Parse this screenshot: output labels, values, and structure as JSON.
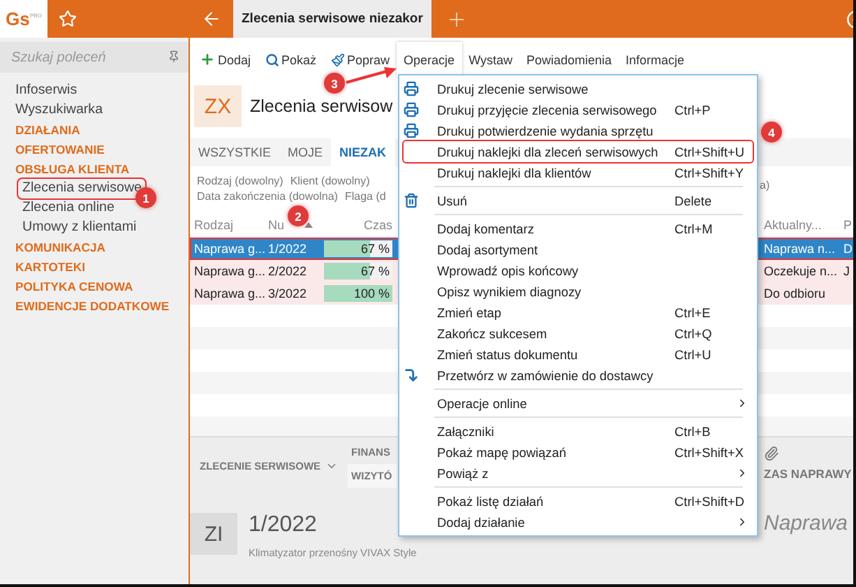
{
  "app": {
    "logo": "Gs",
    "logo_badge": "PRO",
    "tab_title": "Zlecenia serwisowe niezakor"
  },
  "sidebar": {
    "search": {
      "placeholder": "Szukaj poleceń"
    },
    "items": [
      {
        "label": "Infoserwis",
        "kind": "link",
        "highlighted": false
      },
      {
        "label": "Wyszukiwarka",
        "kind": "link",
        "highlighted": false
      },
      {
        "label": "DZIAŁANIA",
        "kind": "section",
        "highlighted": false
      },
      {
        "label": "OFERTOWANIE",
        "kind": "section",
        "highlighted": false
      },
      {
        "label": "OBSŁUGA KLIENTA",
        "kind": "section",
        "highlighted": false
      },
      {
        "label": "Zlecenia serwisowe",
        "kind": "sub",
        "highlighted": true
      },
      {
        "label": "Zlecenia online",
        "kind": "sub",
        "highlighted": false
      },
      {
        "label": "Umowy z klientami",
        "kind": "sub",
        "highlighted": false
      },
      {
        "label": "KOMUNIKACJA",
        "kind": "section",
        "highlighted": false
      },
      {
        "label": "KARTOTEKI",
        "kind": "section",
        "highlighted": false
      },
      {
        "label": "POLITYKA CENOWA",
        "kind": "section",
        "highlighted": false
      },
      {
        "label": "EWIDENCJE DODATKOWE",
        "kind": "section",
        "highlighted": false
      }
    ]
  },
  "toolbar": [
    {
      "label": "Dodaj",
      "kind": "add",
      "selected": false
    },
    {
      "label": "Pokaż",
      "kind": "show",
      "selected": false
    },
    {
      "label": "Popraw",
      "kind": "edit",
      "selected": false
    },
    {
      "label": "Operacje",
      "kind": "text",
      "selected": true
    },
    {
      "label": "Wystaw",
      "kind": "text",
      "selected": false
    },
    {
      "label": "Powiadomienia",
      "kind": "text",
      "selected": false
    },
    {
      "label": "Informacje",
      "kind": "text",
      "selected": false
    }
  ],
  "header": {
    "tile": "ZX",
    "title": "Zlecenia serwisow"
  },
  "tabs": [
    {
      "label": "WSZYSTKIE",
      "selected": false
    },
    {
      "label": "MOJE",
      "selected": false
    },
    {
      "label": "NIEZAK",
      "selected": true
    }
  ],
  "filters": {
    "rows": [
      [
        "Rodzaj (dowolny)",
        "Klient (dowolny)"
      ],
      [
        "Data zakończenia (dowolna)",
        "Flaga (d"
      ]
    ],
    "trailing": "a)"
  },
  "table": {
    "columns": [
      "Rodzaj",
      "Nu",
      "Czas",
      "Aktualny...",
      "P"
    ],
    "rows": [
      {
        "rodzaj": "Naprawa g...",
        "numer": "1/2022",
        "czas": "67 %",
        "level": 0.67,
        "aktualny": "Naprawa n...",
        "column_6": "D",
        "selected": true,
        "highlighted": true
      },
      {
        "rodzaj": "Naprawa g...",
        "numer": "2/2022",
        "czas": "67 %",
        "level": 0.67,
        "aktualny": "Oczekuje n...",
        "column_6": "J",
        "selected": false,
        "highlighted": false
      },
      {
        "rodzaj": "Naprawa g...",
        "numer": "3/2022",
        "czas": "100 %",
        "level": 1,
        "aktualny": "Do odbioru",
        "selected": false,
        "highlighted": false
      }
    ]
  },
  "detail": {
    "tabs": [
      {
        "label": "ZLECENIE SERWISOWE",
        "kind": "dropdown",
        "selected": false
      },
      {
        "label": "FINANS",
        "kind": "plain",
        "selected": false
      },
      {
        "label": "WIZYTÓ",
        "kind": "plain",
        "selected": true
      }
    ],
    "right_tab": "ZAS NAPRAWY",
    "tile": "ZI",
    "number": "1/2022",
    "subtitle": "Klimatyzator przenośny VIVAX Style",
    "status": "Naprawa"
  },
  "menu": {
    "groups": [
      [
        {
          "label": "Drukuj zlecenie serwisowe",
          "kind": "print",
          "highlighted": false
        },
        {
          "label": "Drukuj przyjęcie zlecenia serwisowego",
          "shortcut": "Ctrl+P",
          "kind": "print",
          "highlighted": false
        },
        {
          "label": "Drukuj potwierdzenie wydania sprzętu",
          "kind": "print",
          "highlighted": false
        },
        {
          "label": "Drukuj naklejki dla zleceń serwisowych",
          "shortcut": "Ctrl+Shift+U",
          "kind": "plain",
          "highlighted": true
        },
        {
          "label": "Drukuj naklejki dla klientów",
          "shortcut": "Ctrl+Shift+Y",
          "kind": "plain",
          "highlighted": false
        }
      ],
      [
        {
          "label": "Usuń",
          "shortcut": "Delete",
          "kind": "delete",
          "highlighted": false
        }
      ],
      [
        {
          "label": "Dodaj komentarz",
          "shortcut": "Ctrl+M",
          "kind": "plain",
          "highlighted": false
        },
        {
          "label": "Dodaj asortyment",
          "kind": "plain",
          "highlighted": false
        },
        {
          "label": "Wprowadź opis końcowy",
          "kind": "plain",
          "highlighted": false
        },
        {
          "label": "Opisz wynikiem diagnozy",
          "kind": "plain",
          "highlighted": false
        },
        {
          "label": "Zmień etap",
          "shortcut": "Ctrl+E",
          "kind": "plain",
          "highlighted": false
        },
        {
          "label": "Zakończ sukcesem",
          "shortcut": "Ctrl+Q",
          "kind": "plain",
          "highlighted": false
        },
        {
          "label": "Zmień status dokumentu",
          "shortcut": "Ctrl+U",
          "kind": "plain",
          "highlighted": false
        },
        {
          "label": "Przetwórz w zamówienie do dostawcy",
          "kind": "convert",
          "highlighted": false
        }
      ],
      [
        {
          "label": "Operacje online",
          "kind": "submenu",
          "highlighted": false
        }
      ],
      [
        {
          "label": "Załączniki",
          "shortcut": "Ctrl+B",
          "kind": "plain",
          "highlighted": false
        },
        {
          "label": "Pokaż mapę powiązań",
          "shortcut": "Ctrl+Shift+X",
          "kind": "plain",
          "highlighted": false
        },
        {
          "label": "Powiąż z",
          "kind": "submenu",
          "highlighted": false
        }
      ],
      [
        {
          "label": "Pokaż listę działań",
          "shortcut": "Ctrl+Shift+D",
          "kind": "plain",
          "highlighted": false
        },
        {
          "label": "Dodaj działanie",
          "kind": "submenu",
          "highlighted": false
        }
      ]
    ]
  },
  "annotations": [
    {
      "label": "1",
      "arrow": false
    },
    {
      "label": "2",
      "arrow": false
    },
    {
      "label": "3",
      "arrow": true
    },
    {
      "label": "4",
      "arrow": false
    }
  ]
}
